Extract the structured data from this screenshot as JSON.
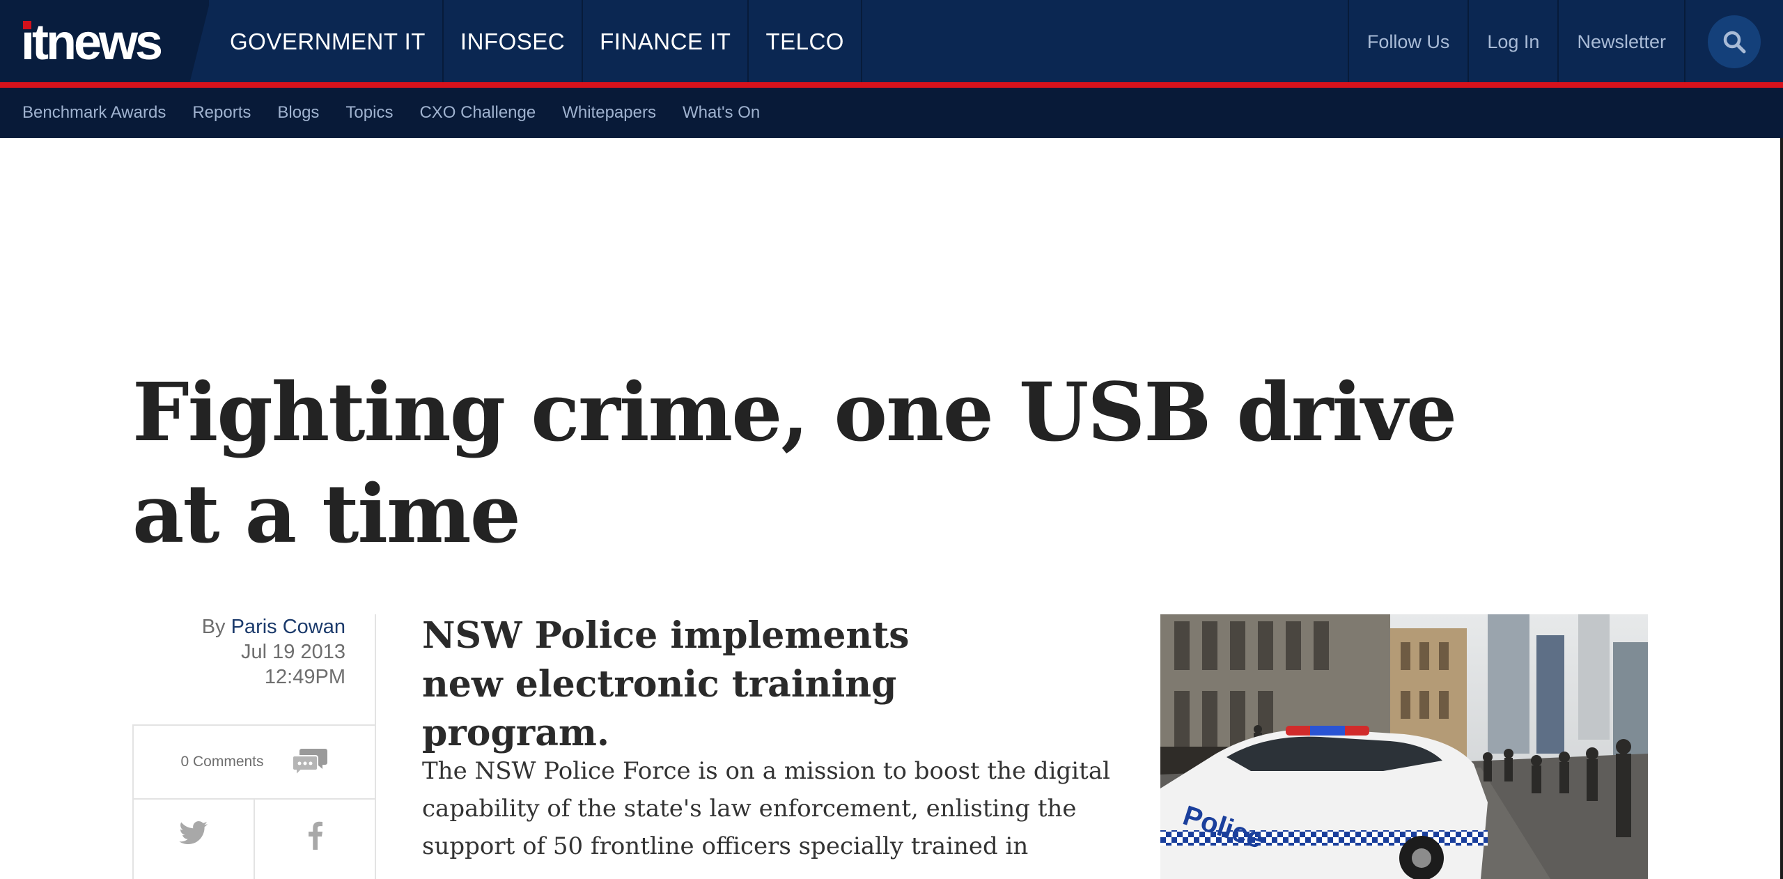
{
  "header": {
    "logo_text": "itnews",
    "main_nav": [
      "GOVERNMENT IT",
      "INFOSEC",
      "FINANCE IT",
      "TELCO"
    ],
    "right_nav": [
      "Follow Us",
      "Log In",
      "Newsletter"
    ],
    "search_icon": "search-icon",
    "colors": {
      "navy": "#0b2752",
      "accent_red": "#d6121c",
      "subnav": "#081a38"
    }
  },
  "subnav": [
    "Benchmark Awards",
    "Reports",
    "Blogs",
    "Topics",
    "CXO Challenge",
    "Whitepapers",
    "What's On"
  ],
  "article": {
    "title": "Fighting crime, one USB drive at a time",
    "byline_prefix": "By",
    "author": "Paris Cowan",
    "date": "Jul 19 2013",
    "time": "12:49PM",
    "comments": "0 Comments",
    "subhead": "NSW Police implements new electronic training program.",
    "body": "The NSW Police Force is on a mission to boost the digital capability of the state's law enforcement, enlisting the support of 50 frontline officers specially trained in",
    "social_icons": [
      "twitter-icon",
      "facebook-icon"
    ],
    "image_text": "Police"
  }
}
